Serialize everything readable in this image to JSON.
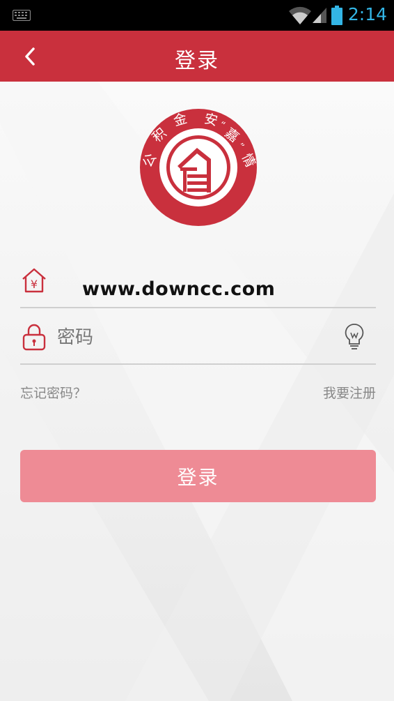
{
  "status_bar": {
    "time": "2:14",
    "keyboard_icon": "keyboard-icon",
    "wifi_icon": "wifi-icon",
    "signal_icon": "signal-icon",
    "battery_icon": "battery-icon",
    "accent_color": "#33b5e5"
  },
  "app_bar": {
    "title": "登录",
    "back_icon": "chevron-left-icon",
    "color": "#c9303d"
  },
  "logo": {
    "arc_text": [
      "公",
      "积",
      "金",
      "安",
      "“",
      "嘉",
      "”",
      "情"
    ],
    "color": "#c9303d"
  },
  "form": {
    "username": {
      "value": "",
      "placeholder": "",
      "icon": "house-yuan-icon"
    },
    "password": {
      "value": "",
      "placeholder": "密码",
      "icon": "lock-icon",
      "toggle_icon": "lightbulb-icon"
    },
    "forgot_link": "忘记密码？",
    "register_link": "我要注册",
    "login_button": "登录",
    "button_color": "#ee8b95"
  },
  "watermark": "www.downcc.com"
}
